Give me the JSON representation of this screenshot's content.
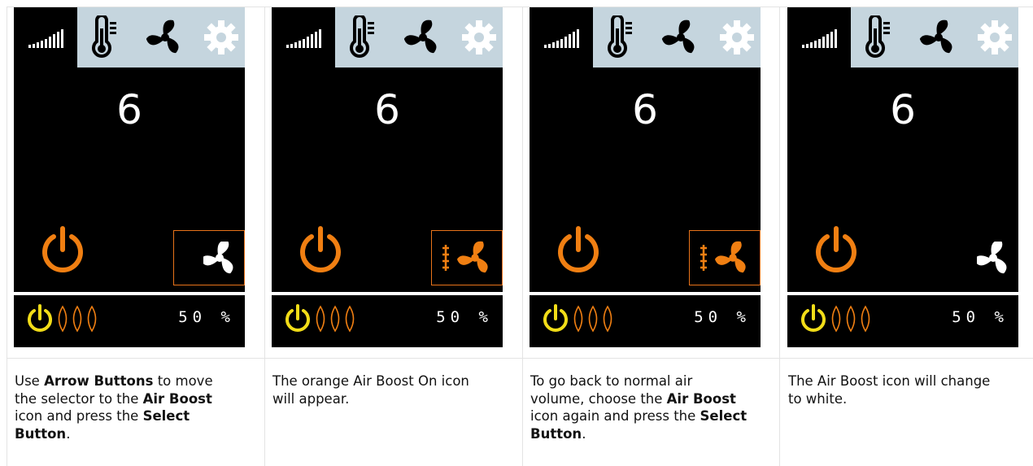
{
  "panels": [
    {
      "value": "6",
      "percent": "50 %",
      "air_boost_state": "selected",
      "caption": [
        {
          "t": "Use ",
          "b": false
        },
        {
          "t": "Arrow Buttons",
          "b": true
        },
        {
          "t": " to move the selector to the ",
          "b": false
        },
        {
          "t": "Air Boost",
          "b": true
        },
        {
          "t": " icon and press the ",
          "b": false
        },
        {
          "t": "Select Button",
          "b": true
        },
        {
          "t": ".",
          "b": false
        }
      ]
    },
    {
      "value": "6",
      "percent": "50 %",
      "air_boost_state": "on",
      "caption": [
        {
          "t": "The orange Air Boost On icon will appear.",
          "b": false
        }
      ]
    },
    {
      "value": "6",
      "percent": "50 %",
      "air_boost_state": "on",
      "caption": [
        {
          "t": "To go back to normal air volume, choose the ",
          "b": false
        },
        {
          "t": "Air Boost",
          "b": true
        },
        {
          "t": " icon again and press the ",
          "b": false
        },
        {
          "t": "Select Button",
          "b": true
        },
        {
          "t": ".",
          "b": false
        }
      ]
    },
    {
      "value": "6",
      "percent": "50 %",
      "air_boost_state": "off",
      "caption": [
        {
          "t": "The Air Boost icon will change to white.",
          "b": false
        }
      ]
    }
  ],
  "colors": {
    "orange": "#f07f12",
    "yellow": "#f2dd18",
    "tab_bg": "#c5d5de",
    "screen_bg": "#000000"
  },
  "icons": [
    "signal-icon",
    "thermometer-icon",
    "fan-icon",
    "gear-icon",
    "power-icon",
    "humidity-drops-icon",
    "air-boost-icon"
  ]
}
